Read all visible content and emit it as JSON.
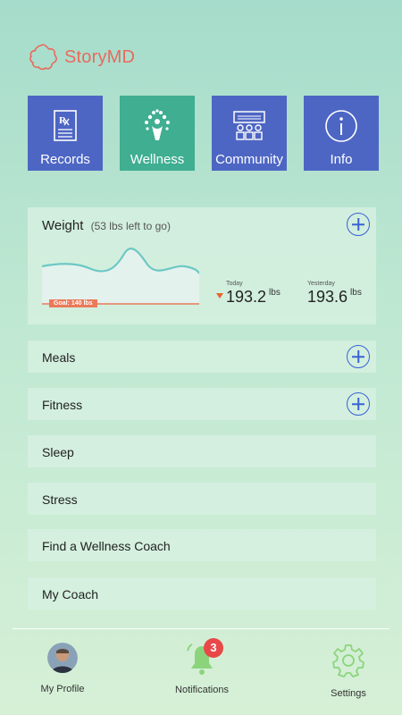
{
  "app": {
    "brand": "StoryMD"
  },
  "tiles": [
    {
      "label": "Records",
      "icon": "prescription-icon"
    },
    {
      "label": "Wellness",
      "icon": "wellness-tree-icon",
      "active": true
    },
    {
      "label": "Community",
      "icon": "community-group-icon"
    },
    {
      "label": "Info",
      "icon": "info-icon"
    }
  ],
  "weight": {
    "title": "Weight",
    "subtitle": "(53 lbs left to go)",
    "goal_badge": "Goal: 140 lbs",
    "today": {
      "label": "Today",
      "value": "193.2",
      "unit": "lbs",
      "trend": "down"
    },
    "yesterday": {
      "label": "Yesterday",
      "value": "193.6",
      "unit": "lbs"
    }
  },
  "rows": [
    {
      "label": "Meals",
      "has_add": true
    },
    {
      "label": "Fitness",
      "has_add": true
    },
    {
      "label": "Sleep"
    },
    {
      "label": "Stress"
    },
    {
      "label": "Find a Wellness Coach"
    },
    {
      "label": "My Coach"
    }
  ],
  "nav": {
    "profile": "My Profile",
    "notifications": "Notifications",
    "notification_count": "3",
    "settings": "Settings"
  },
  "colors": {
    "tile": "#4d66c4",
    "tile_active": "#3fae91",
    "brand": "#e86a5e",
    "accent": "#3a63d6",
    "badge": "#e94848",
    "chart_line": "#6cc8c4",
    "goal": "#ea7a5a"
  }
}
